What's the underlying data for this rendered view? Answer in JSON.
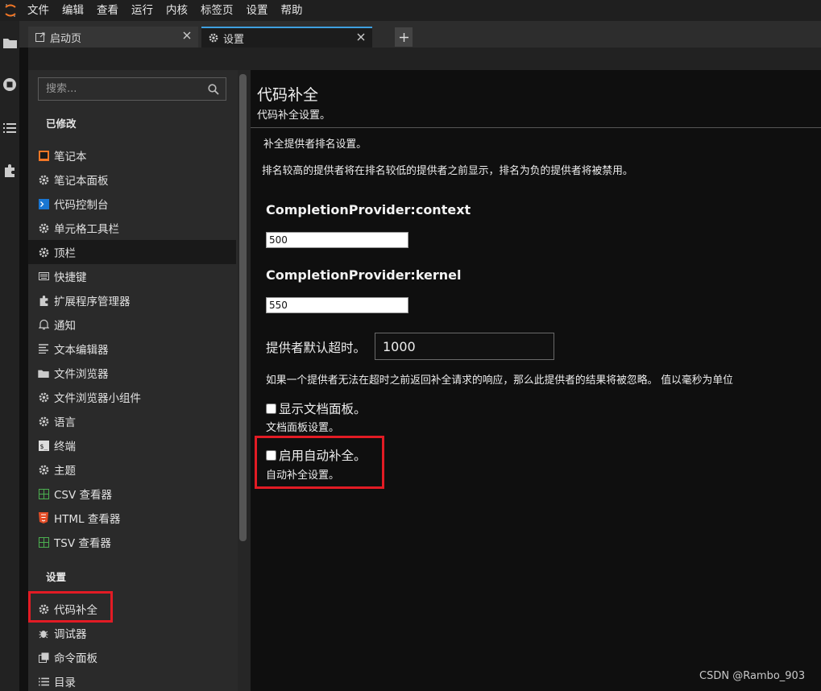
{
  "menubar": {
    "items": [
      "文件",
      "编辑",
      "查看",
      "运行",
      "内核",
      "标签页",
      "设置",
      "帮助"
    ]
  },
  "tabs": [
    {
      "label": "启动页",
      "icon": "launcher-icon"
    },
    {
      "label": "设置",
      "icon": "gear-icon"
    }
  ],
  "search": {
    "placeholder": "搜索..."
  },
  "sidebar": {
    "modified_header": "已修改",
    "settings_header": "设置",
    "modified_items": [
      {
        "label": "笔记本",
        "icon": "notebook-icon"
      },
      {
        "label": "笔记本面板",
        "icon": "gear-icon"
      },
      {
        "label": "代码控制台",
        "icon": "console-icon"
      },
      {
        "label": "单元格工具栏",
        "icon": "gear-icon"
      },
      {
        "label": "顶栏",
        "icon": "gear-icon"
      },
      {
        "label": "快捷键",
        "icon": "keyboard-icon"
      },
      {
        "label": "扩展程序管理器",
        "icon": "puzzle-icon"
      },
      {
        "label": "通知",
        "icon": "bell-icon"
      },
      {
        "label": "文本编辑器",
        "icon": "text-editor-icon"
      },
      {
        "label": "文件浏览器",
        "icon": "folder-icon"
      },
      {
        "label": "文件浏览器小组件",
        "icon": "gear-icon"
      },
      {
        "label": "语言",
        "icon": "gear-icon"
      },
      {
        "label": "终端",
        "icon": "terminal-icon"
      },
      {
        "label": "主题",
        "icon": "gear-icon"
      },
      {
        "label": "CSV 查看器",
        "icon": "csv-grid-icon"
      },
      {
        "label": "HTML 查看器",
        "icon": "html5-icon"
      },
      {
        "label": "TSV 查看器",
        "icon": "tsv-grid-icon"
      }
    ],
    "settings_items": [
      {
        "label": "代码补全",
        "icon": "gear-icon"
      },
      {
        "label": "调试器",
        "icon": "bug-icon"
      },
      {
        "label": "命令面板",
        "icon": "palette-icon"
      },
      {
        "label": "目录",
        "icon": "list-icon"
      }
    ]
  },
  "main": {
    "title": "代码补全",
    "subtitle": "代码补全设置。",
    "ranking_title": "补全提供者排名设置。",
    "ranking_desc": "排名较高的提供者将在排名较低的提供者之前显示，排名为负的提供者将被禁用。",
    "provider_context_label": "CompletionProvider:context",
    "provider_context_value": "500",
    "provider_kernel_label": "CompletionProvider:kernel",
    "provider_kernel_value": "550",
    "timeout_label": "提供者默认超时。",
    "timeout_value": "1000",
    "timeout_desc": "如果一个提供者无法在超时之前返回补全请求的响应，那么此提供者的结果将被忽略。 值以毫秒为单位",
    "show_doc_label": "显示文档面板。",
    "show_doc_checked": false,
    "show_doc_sub": "文档面板设置。",
    "auto_complete_label": "启用自动补全。",
    "auto_complete_checked": false,
    "auto_complete_sub": "自动补全设置。"
  },
  "watermark": "CSDN @Rambo_903",
  "colors": {
    "highlight": "#e21b24",
    "accent": "#3fa0e0",
    "logo": "#f37726"
  }
}
